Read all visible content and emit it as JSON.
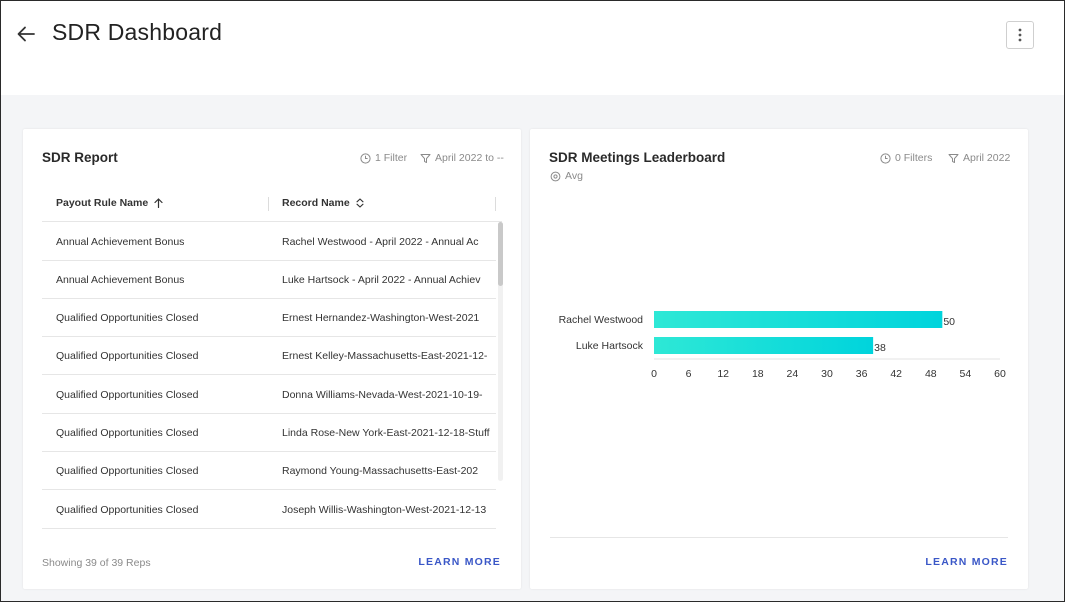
{
  "header": {
    "title": "SDR Dashboard"
  },
  "report": {
    "title": "SDR Report",
    "filter_count": "1 Filter",
    "date_filter": "April 2022 to --",
    "columns": [
      "Payout Rule Name",
      "Record Name"
    ],
    "rows": [
      [
        "Annual Achievement Bonus",
        "Rachel Westwood - April 2022 - Annual Ac"
      ],
      [
        "Annual Achievement Bonus",
        "Luke Hartsock - April 2022 - Annual Achiev"
      ],
      [
        "Qualified Opportunities Closed",
        "Ernest Hernandez-Washington-West-2021"
      ],
      [
        "Qualified Opportunities Closed",
        "Ernest Kelley-Massachusetts-East-2021-12-"
      ],
      [
        "Qualified Opportunities Closed",
        "Donna Williams-Nevada-West-2021-10-19-"
      ],
      [
        "Qualified Opportunities Closed",
        "Linda Rose-New York-East-2021-12-18-Stuff"
      ],
      [
        "Qualified Opportunities Closed",
        "Raymond Young-Massachusetts-East-202"
      ],
      [
        "Qualified Opportunities Closed",
        "Joseph Willis-Washington-West-2021-12-13"
      ]
    ],
    "footer": "Showing 39 of 39 Reps",
    "learn_more": "LEARN MORE"
  },
  "leaderboard": {
    "title": "SDR Meetings Leaderboard",
    "filter_count": "0 Filters",
    "date_filter": "April 2022",
    "aggregate": "Avg",
    "learn_more": "LEARN MORE"
  },
  "colors": {
    "bar_start": "#2ee8d6",
    "bar_end": "#00d4dc",
    "link": "#3a57c7"
  },
  "chart_data": {
    "type": "bar",
    "orientation": "horizontal",
    "categories": [
      "Rachel Westwood",
      "Luke Hartsock"
    ],
    "values": [
      50,
      38
    ],
    "xlim": [
      0,
      60
    ],
    "xticks": [
      0,
      6,
      12,
      18,
      24,
      30,
      36,
      42,
      48,
      54,
      60
    ],
    "data_labels": true,
    "grid": false,
    "legend": "none"
  }
}
